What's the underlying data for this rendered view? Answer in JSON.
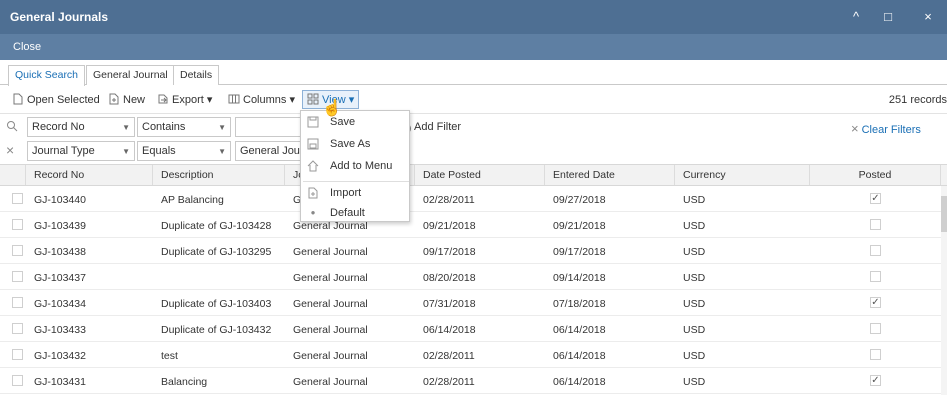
{
  "window": {
    "title": "General Journals",
    "minimize_glyph": "^",
    "maximize_glyph": "□",
    "close_glyph": "×"
  },
  "closebar": {
    "close_label": "Close"
  },
  "tabs": [
    {
      "label": "Quick Search"
    },
    {
      "label": "General Journal"
    },
    {
      "label": "Details"
    }
  ],
  "toolbar": {
    "open_selected": "Open Selected",
    "new": "New",
    "export": "Export ▾",
    "columns": "Columns ▾",
    "view": "View ▾",
    "records": "251 records"
  },
  "filters": [
    {
      "field": "Record No",
      "operator": "Contains",
      "value": ""
    },
    {
      "field": "Journal Type",
      "operator": "Equals",
      "value": "General Jour"
    }
  ],
  "add_filter": "Add Filter",
  "clear_filters": "Clear Filters",
  "columns": [
    "Record No",
    "Description",
    "Jo",
    "Date Posted",
    "Entered Date",
    "Currency",
    "Posted"
  ],
  "rows": [
    {
      "record_no": "GJ-103440",
      "description": "AP Balancing",
      "journal": "G",
      "date_posted": "02/28/2011",
      "entered_date": "09/27/2018",
      "currency": "USD",
      "posted": "✓"
    },
    {
      "record_no": "GJ-103439",
      "description": "Duplicate of GJ-103428",
      "journal": "General Journal",
      "date_posted": "09/21/2018",
      "entered_date": "09/21/2018",
      "currency": "USD",
      "posted": ""
    },
    {
      "record_no": "GJ-103438",
      "description": "Duplicate of GJ-103295",
      "journal": "General Journal",
      "date_posted": "09/17/2018",
      "entered_date": "09/17/2018",
      "currency": "USD",
      "posted": ""
    },
    {
      "record_no": "GJ-103437",
      "description": "",
      "journal": "General Journal",
      "date_posted": "08/20/2018",
      "entered_date": "09/14/2018",
      "currency": "USD",
      "posted": ""
    },
    {
      "record_no": "GJ-103434",
      "description": "Duplicate of GJ-103403",
      "journal": "General Journal",
      "date_posted": "07/31/2018",
      "entered_date": "07/18/2018",
      "currency": "USD",
      "posted": "✓"
    },
    {
      "record_no": "GJ-103433",
      "description": "Duplicate of GJ-103432",
      "journal": "General Journal",
      "date_posted": "06/14/2018",
      "entered_date": "06/14/2018",
      "currency": "USD",
      "posted": ""
    },
    {
      "record_no": "GJ-103432",
      "description": "test",
      "journal": "General Journal",
      "date_posted": "02/28/2011",
      "entered_date": "06/14/2018",
      "currency": "USD",
      "posted": ""
    },
    {
      "record_no": "GJ-103431",
      "description": "Balancing",
      "journal": "General Journal",
      "date_posted": "02/28/2011",
      "entered_date": "06/14/2018",
      "currency": "USD",
      "posted": "✓"
    }
  ],
  "view_menu": [
    {
      "label": "Save",
      "icon": "save-icon"
    },
    {
      "label": "Save As",
      "icon": "save-as-icon"
    },
    {
      "label": "Add to Menu",
      "icon": "home-icon"
    },
    {
      "label": "Import",
      "icon": "import-icon"
    },
    {
      "label": "Default",
      "icon": "dot-icon"
    }
  ],
  "colors": {
    "titlebar": "#4e6f93",
    "closebar": "#5e7fa3",
    "accent": "#1a6fb5"
  }
}
